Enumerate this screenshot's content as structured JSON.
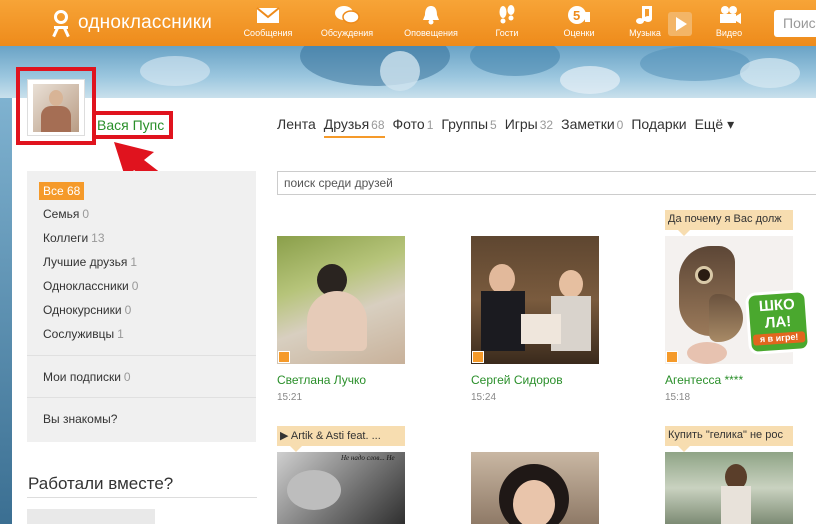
{
  "header": {
    "site_name": "одноклассники",
    "search_placeholder": "Поис",
    "nav": [
      {
        "label": "Сообщения",
        "icon": "envelope-icon"
      },
      {
        "label": "Обсуждения",
        "icon": "chat-bubbles-icon"
      },
      {
        "label": "Оповещения",
        "icon": "bell-icon"
      },
      {
        "label": "Гости",
        "icon": "footprints-icon"
      },
      {
        "label": "Оценки",
        "icon": "rating-5-icon"
      },
      {
        "label": "Музыка",
        "icon": "music-note-icon"
      },
      {
        "label": "Видео",
        "icon": "video-camera-icon"
      }
    ]
  },
  "profile": {
    "name": "Вася Пупс"
  },
  "tabs": [
    {
      "label": "Лента",
      "count": ""
    },
    {
      "label": "Друзья",
      "count": "68"
    },
    {
      "label": "Фото",
      "count": "1"
    },
    {
      "label": "Группы",
      "count": "5"
    },
    {
      "label": "Игры",
      "count": "32"
    },
    {
      "label": "Заметки",
      "count": "0"
    },
    {
      "label": "Подарки",
      "count": ""
    },
    {
      "label": "Ещё ▾",
      "count": ""
    }
  ],
  "filters": {
    "all": "Все 68",
    "items": [
      {
        "label": "Семья",
        "count": "0"
      },
      {
        "label": "Коллеги",
        "count": "13"
      },
      {
        "label": "Лучшие друзья",
        "count": "1"
      },
      {
        "label": "Одноклассники",
        "count": "0"
      },
      {
        "label": "Однокурсники",
        "count": "0"
      },
      {
        "label": "Сослуживцы",
        "count": "1"
      }
    ],
    "subscriptions": {
      "label": "Мои подписки",
      "count": "0"
    },
    "know": "Вы знакомы?"
  },
  "worked_together": "Работали вместе?",
  "friend_search_placeholder": "поиск среди друзей",
  "friends": [
    {
      "name": "Светлана Лучко",
      "time": "15:21",
      "status": ""
    },
    {
      "name": "Сергей Сидоров",
      "time": "15:24",
      "status": ""
    },
    {
      "name": "Агентесса ****",
      "time": "15:18",
      "status": "Да почему я Вас долж"
    }
  ],
  "friends_row2": [
    {
      "status": "▶ Artik & Asti feat. ..."
    },
    {
      "status": ""
    },
    {
      "status": "Купить \"гелика\" не рос"
    }
  ],
  "badge": {
    "line1": "ШКО",
    "line2": "ЛА!",
    "line3": "я в игре!"
  },
  "photo_caption_1": "Не надо слов... Не",
  "colors": {
    "accent": "#f59a2a",
    "link": "#2a8f2a",
    "highlight": "#e0131e"
  }
}
